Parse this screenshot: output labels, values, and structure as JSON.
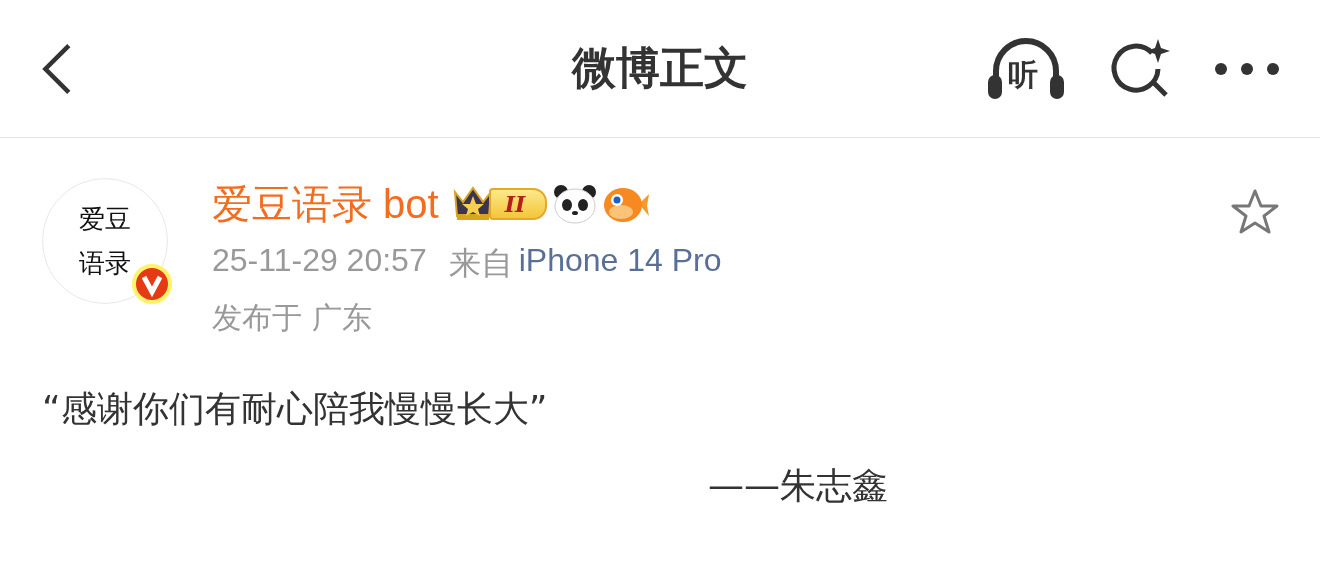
{
  "nav": {
    "title": "微博正文",
    "listen_label": "听"
  },
  "post": {
    "avatar_lines": [
      "爱豆",
      "语录"
    ],
    "verified": true,
    "author": "爱豆语录 bot",
    "level_badge": "II",
    "time": "25-11-29 20:57",
    "source_prefix": "来自",
    "source": "iPhone 14 Pro",
    "location": "发布于 广东",
    "favorited": false,
    "body": "“感谢你们有耐心陪我慢慢长大”",
    "signature": "——朱志鑫"
  }
}
